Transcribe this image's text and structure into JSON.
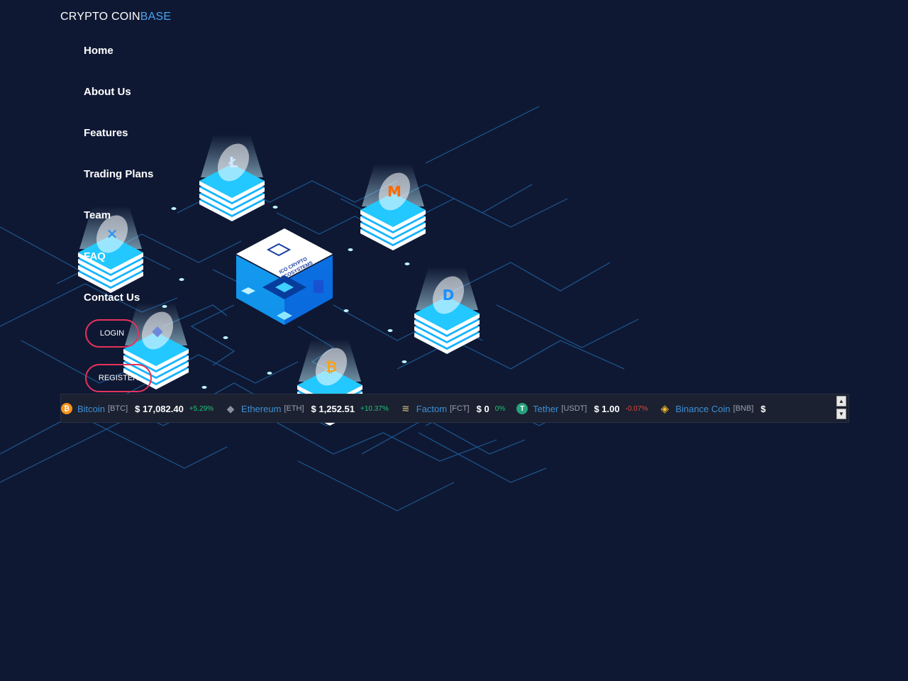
{
  "brand": {
    "name_main": "CRYPTO COIN",
    "name_accent": "BASE"
  },
  "nav": {
    "items": [
      {
        "label": "Home"
      },
      {
        "label": "About Us"
      },
      {
        "label": "Features"
      },
      {
        "label": "Trading Plans"
      },
      {
        "label": "Team"
      },
      {
        "label": "FAQ"
      },
      {
        "label": "Contact Us"
      }
    ],
    "login_label": "LOGIN",
    "register_label": "REGISTER"
  },
  "hero": {
    "server_label_line1": "ICO CRYPTO",
    "server_label_line2": "ECOSYSTEMS"
  },
  "ticker": {
    "items": [
      {
        "name": "Bitcoin",
        "symbol": "[BTC]",
        "price": "$ 17,082.40",
        "change": "+5.29%",
        "direction": "up",
        "icon": "bitcoin-icon",
        "color": "#f7931a"
      },
      {
        "name": "Ethereum",
        "symbol": "[ETH]",
        "price": "$ 1,252.51",
        "change": "+10.37%",
        "direction": "up",
        "icon": "ethereum-icon",
        "color": "#627eea"
      },
      {
        "name": "Factom",
        "symbol": "[FCT]",
        "price": "$ 0",
        "change": "0%",
        "direction": "up",
        "icon": "factom-icon",
        "color": "#b9a775"
      },
      {
        "name": "Tether",
        "symbol": "[USDT]",
        "price": "$ 1.00",
        "change": "-0.07%",
        "direction": "down",
        "icon": "tether-icon",
        "color": "#26a17b"
      },
      {
        "name": "Binance Coin",
        "symbol": "[BNB]",
        "price": "$",
        "change": "",
        "direction": "up",
        "icon": "binance-icon",
        "color": "#f3ba2f"
      }
    ]
  },
  "colors": {
    "background": "#0f1833",
    "accent": "#4aa3f0",
    "button_border": "#e5335b",
    "ticker_bg": "#1b2130"
  }
}
